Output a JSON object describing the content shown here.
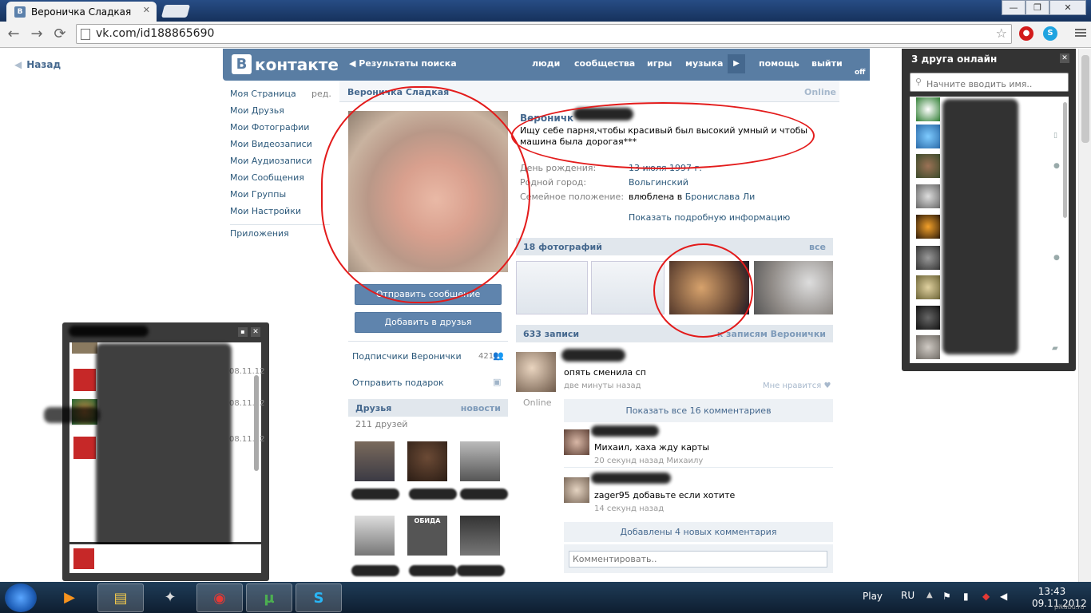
{
  "browser": {
    "tab_title": "Вероничка Сладкая",
    "tab_favicon": "В",
    "url": "vk.com/id188865690",
    "window_controls": [
      "—",
      "❐",
      "✕"
    ]
  },
  "page": {
    "back_link": "Назад"
  },
  "vk_header": {
    "logo_letter": "В",
    "logo_text": "контакте",
    "search_results": "Результаты поиска",
    "nav": [
      "люди",
      "сообщества",
      "игры",
      "музыка",
      "помощь",
      "выйти"
    ],
    "off_label": "off"
  },
  "left_menu": {
    "items": [
      "Моя Страница",
      "Мои Друзья",
      "Мои Фотографии",
      "Мои Видеозаписи",
      "Мои Аудиозаписи",
      "Мои Сообщения",
      "Мои Группы",
      "Мои Настройки"
    ],
    "edit_label": "ред.",
    "apps": "Приложения"
  },
  "profile": {
    "name": "Вероничка Сладкая",
    "online_status": "Online",
    "full_name": "Вероничк",
    "status_text": "Ищу себе парня,чтобы красивый был высокий умный и чтобы машина была дорогая***",
    "info": [
      {
        "label": "День рождения:",
        "value": "13 июля 1997 г."
      },
      {
        "label": "Родной город:",
        "value": "Вольгинский"
      },
      {
        "label": "Семейное положение:",
        "value": "влюблена в ",
        "link": "Бронислава Ли"
      }
    ],
    "show_more": "Показать подробную информацию",
    "send_message": "Отправить сообщение",
    "add_friend": "Добавить в друзья",
    "subscribers": "Подписчики Веронички",
    "subscribers_count": "421",
    "send_gift": "Отправить подарок",
    "friends_title": "Друзья",
    "friends_news": "новости",
    "friends_count": "211 друзей",
    "meme_caption": "ОБИДА"
  },
  "photos": {
    "title": "18 фотографий",
    "all_link": "все"
  },
  "wall": {
    "title": "633 записи",
    "to_wall": "к записям Веронички",
    "post_text": "опять сменила сп",
    "post_time": "две минуты назад",
    "post_like": "Мне нравится",
    "post_online": "Online",
    "show_all_comments": "Показать все 16 комментариев",
    "comments": [
      {
        "text": "Михаил, хаха жду карты",
        "time": "20 секунд назад Михаилу"
      },
      {
        "text": "zager95 добавьте если хотите",
        "time": "14 секунд назад"
      }
    ],
    "new_comments": "Добавлены 4 новых комментария",
    "comment_placeholder": "Комментировать.."
  },
  "friends_online": {
    "title": "3 друга онлайн",
    "search_placeholder": "Начните вводить имя.."
  },
  "chat": {
    "dates": [
      "08.11.12",
      "08.11.12",
      "08.11.12"
    ]
  },
  "taskbar": {
    "play": "Play",
    "lang": "RU",
    "time": "13:43",
    "date": "09.11.2012",
    "watermark": "pikabu.ru"
  },
  "colors": {
    "vk_blue": "#597da3",
    "link": "#2b587a",
    "red_circle": "#e31b1b"
  }
}
